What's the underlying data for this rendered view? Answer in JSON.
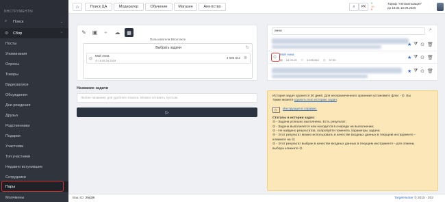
{
  "sidebar": {
    "heading": "ИНСТРУМЕНТЫ",
    "search_label": "Поиск",
    "group_label": "Сбор",
    "items": [
      "Посты",
      "Упоминания",
      "Опросы",
      "Товары",
      "Видеозаписи",
      "Обсуждения",
      "Дни рождения",
      "Друзья",
      "Родственники",
      "Подарки",
      "Участники",
      "Топ участники",
      "Недавно вступившие",
      "Сотрудники",
      "Пары",
      "Молчмены"
    ],
    "active_item": "Пары"
  },
  "topbar": {
    "nav": [
      "Поиск ЦА",
      "Модератор",
      "Обучение",
      "Магазин",
      "Агентство"
    ],
    "rk_label": "РК",
    "counters": [
      "0",
      "10",
      "0"
    ],
    "tariff_line1": "Тариф \"Автоматизация\"",
    "tariff_line2": "до 18:34 10.09.2020"
  },
  "left_panel": {
    "source_label": "Пользователи ВКонтакте",
    "select_task_label": "Выбрать задачи",
    "task_name": "Мой Анна",
    "task_date": "19.05.16 2019",
    "task_count": "4 696 842",
    "task_name_title": "Название задачи",
    "task_name_placeholder": "Любое название для удобного поиска. Можно оставить пустым."
  },
  "right_panel": {
    "search_value": "анна",
    "result_name": "Мой Анна",
    "result_date": "15.09.19",
    "result_count": "4 696 842",
    "result_time": "57:00"
  },
  "notice": {
    "line1": "История задач хранится 30 дней. Для неограниченного хранения установите флаг - ⊙. Вы",
    "line2_prefix": "также можете ",
    "line2_link": "удалить всю историю задач",
    "line2_suffix": ".",
    "instruction_link": "Инструкция в справке.",
    "status_title": "Статусы в истории задач:",
    "statuses": [
      "⊙ - Задача успешно выполнена. Есть результат;",
      "⊙ - Задача выполняется или находится в очереди на выполнение;",
      "⊙ - Не найдено результатов, попробуйте поменять параметры задачи;",
      "⊙ - Этот результат можно использовать в качестве входных данных в текущем инструменте -",
      "кликните на ⊙;",
      "⊙ - Этот результат выбран в качестве входных данных в текущем инструменте - для отмены",
      "выбора кликните ⊙."
    ]
  },
  "footer": {
    "vk_id_label": "Ваш ID:",
    "vk_id": "25439",
    "brand": "TargetHunter",
    "copyright": "© 2015 - 202"
  },
  "colors": {
    "sidebar_bg": "#2b2e36",
    "accent_dark": "#2c3340",
    "notice_bg": "#fbe7b8",
    "highlight": "#d9342b",
    "link": "#2f6cc0"
  }
}
